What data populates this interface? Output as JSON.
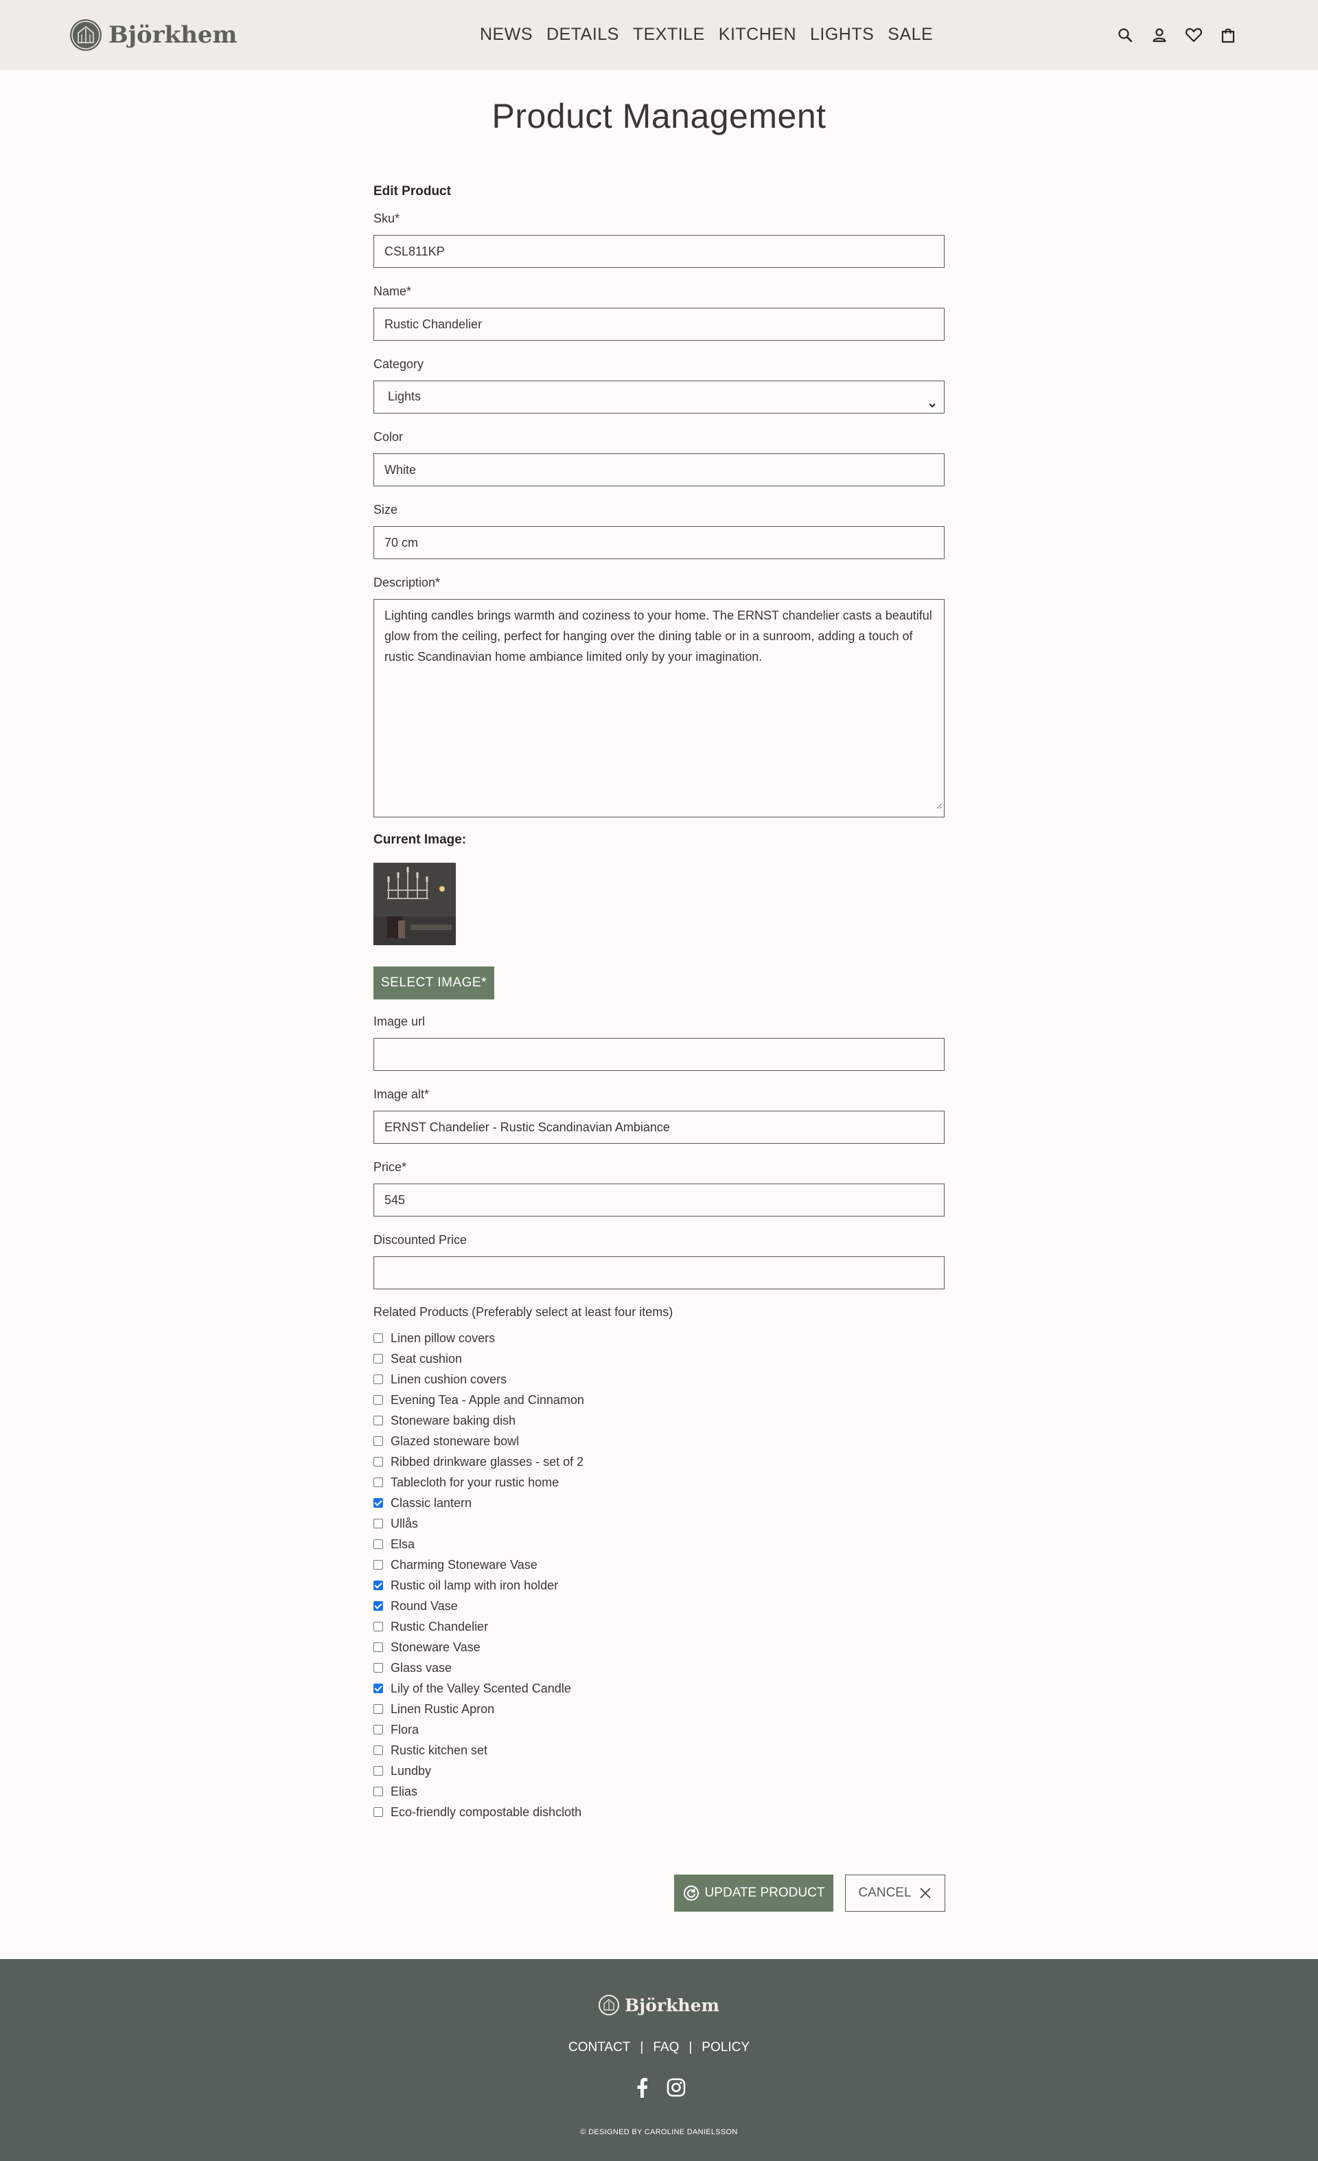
{
  "header": {
    "brand": "Björkhem",
    "nav": [
      "NEWS",
      "DETAILS",
      "TEXTILE",
      "KITCHEN",
      "LIGHTS",
      "SALE"
    ],
    "icons": [
      "search-icon",
      "user-icon",
      "heart-icon",
      "shopping-bag-icon"
    ]
  },
  "page": {
    "title": "Product Management"
  },
  "form": {
    "heading": "Edit Product",
    "sku": {
      "label": "Sku*",
      "value": "CSL811KP"
    },
    "name": {
      "label": "Name*",
      "value": "Rustic Chandelier"
    },
    "category": {
      "label": "Category",
      "value": "Lights"
    },
    "color": {
      "label": "Color",
      "value": "White"
    },
    "size": {
      "label": "Size",
      "value": "70 cm"
    },
    "description": {
      "label": "Description*",
      "value": "Lighting candles brings warmth and coziness to your home. The ERNST chandelier casts a beautiful glow from the ceiling, perfect for hanging over the dining table or in a sunroom, adding a touch of rustic Scandinavian home ambiance limited only by your imagination."
    },
    "current_image_label": "Current Image:",
    "select_image_label": "SELECT IMAGE*",
    "image_url": {
      "label": "Image url",
      "value": ""
    },
    "image_alt": {
      "label": "Image alt*",
      "value": "ERNST Chandelier - Rustic Scandinavian Ambiance"
    },
    "price": {
      "label": "Price*",
      "value": "545"
    },
    "discounted_price": {
      "label": "Discounted Price",
      "value": ""
    },
    "related_label": "Related Products (Preferably select at least four items)",
    "related": [
      {
        "label": "Linen pillow covers",
        "checked": false
      },
      {
        "label": "Seat cushion",
        "checked": false
      },
      {
        "label": "Linen cushion covers",
        "checked": false
      },
      {
        "label": "Evening Tea - Apple and Cinnamon",
        "checked": false
      },
      {
        "label": "Stoneware baking dish",
        "checked": false
      },
      {
        "label": "Glazed stoneware bowl",
        "checked": false
      },
      {
        "label": "Ribbed drinkware glasses - set of 2",
        "checked": false
      },
      {
        "label": "Tablecloth for your rustic home",
        "checked": false
      },
      {
        "label": "Classic lantern",
        "checked": true
      },
      {
        "label": "Ullås",
        "checked": false
      },
      {
        "label": "Elsa",
        "checked": false
      },
      {
        "label": "Charming Stoneware Vase",
        "checked": false
      },
      {
        "label": "Rustic oil lamp with iron holder",
        "checked": true
      },
      {
        "label": "Round Vase",
        "checked": true
      },
      {
        "label": "Rustic Chandelier",
        "checked": false
      },
      {
        "label": "Stoneware Vase",
        "checked": false
      },
      {
        "label": "Glass vase",
        "checked": false
      },
      {
        "label": "Lily of the Valley Scented Candle",
        "checked": true
      },
      {
        "label": "Linen Rustic Apron",
        "checked": false
      },
      {
        "label": "Flora",
        "checked": false
      },
      {
        "label": "Rustic kitchen set",
        "checked": false
      },
      {
        "label": "Lundby",
        "checked": false
      },
      {
        "label": "Elias",
        "checked": false
      },
      {
        "label": "Eco-friendly compostable dishcloth",
        "checked": false
      }
    ],
    "update_label": "UPDATE PRODUCT",
    "cancel_label": "CANCEL"
  },
  "footer": {
    "brand": "Björkhem",
    "links": [
      "CONTACT",
      "FAQ",
      "POLICY"
    ],
    "separator": "|",
    "social_icons": [
      "facebook-icon",
      "instagram-icon"
    ],
    "credit": "© DESIGNED BY CAROLINE DANIELSSON"
  },
  "colors": {
    "header_bg": "#efebe6",
    "page_bg": "#fdfcf8",
    "accent_green": "#6a7c66",
    "footer_bg": "#565f58",
    "checkbox_blue": "#1a73e8"
  }
}
